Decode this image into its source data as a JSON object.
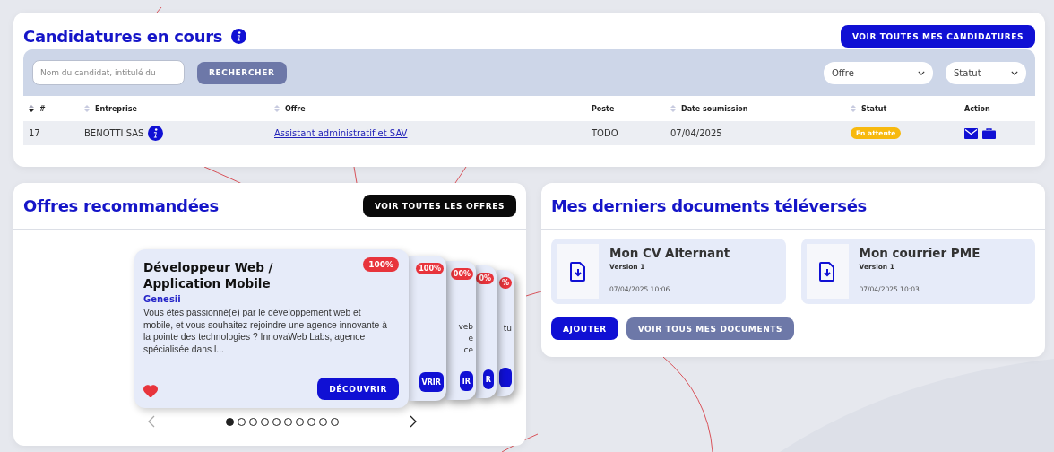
{
  "applications": {
    "title": "Candidatures en cours",
    "view_all": "VOIR TOUTES MES CANDIDATURES",
    "search": {
      "placeholder": "Nom du candidat, intitulé du",
      "button": "RECHERCHER"
    },
    "filters": [
      {
        "label": "Offre"
      },
      {
        "label": "Statut"
      }
    ],
    "columns": [
      {
        "label": "#",
        "sortable": true,
        "sorted": true
      },
      {
        "label": "Entreprise",
        "sortable": true,
        "sorted": false
      },
      {
        "label": "Offre",
        "sortable": true,
        "sorted": false
      },
      {
        "label": "Poste",
        "sortable": false,
        "sorted": false
      },
      {
        "label": "Date soumission",
        "sortable": true,
        "sorted": false
      },
      {
        "label": "Statut",
        "sortable": true,
        "sorted": false
      },
      {
        "label": "Action",
        "sortable": false,
        "sorted": false
      }
    ],
    "rows": [
      {
        "id": "17",
        "company": "BENOTTI SAS",
        "offer": "Assistant administratif et SAV",
        "position": "TODO",
        "date": "07/04/2025",
        "status": "En attente"
      }
    ]
  },
  "offers": {
    "title": "Offres recommandées",
    "view_all": "VOIR TOUTES LES OFFRES",
    "card": {
      "title": "Développeur Web / Application Mobile",
      "match": "100%",
      "company": "Genesii",
      "description": "Vous êtes passionné(e) par le développement web et mobile, et vous souhaitez rejoindre une agence innovante à la pointe des technologies ? InnovaWeb Labs, agence spécialisée dans l...",
      "favorite": true,
      "button": "DÉCOUVRIR"
    },
    "back_cards": [
      {
        "match": "100%",
        "button": "VRIR"
      },
      {
        "match": "00%",
        "fragments": [
          "veb",
          "e",
          "ce"
        ],
        "button": "IR"
      },
      {
        "match": "0%",
        "button": "R"
      },
      {
        "match": "%",
        "fragments": [
          "tu"
        ]
      }
    ],
    "carousel": {
      "prev_disabled": true,
      "dots": [
        {
          "selected": true
        },
        {
          "selected": false
        },
        {
          "selected": false
        },
        {
          "selected": false
        },
        {
          "selected": false
        },
        {
          "selected": false
        },
        {
          "selected": false
        },
        {
          "selected": false
        },
        {
          "selected": false
        },
        {
          "selected": false
        }
      ]
    }
  },
  "documents": {
    "title": "Mes derniers documents téléversés",
    "items": [
      {
        "name": "Mon CV Alternant",
        "version": "Version 1",
        "date": "07/04/2025 10:06"
      },
      {
        "name": "Mon courrier PME",
        "version": "Version 1",
        "date": "07/04/2025 10:03"
      }
    ],
    "add": "AJOUTER",
    "view_all": "VOIR TOUS MES DOCUMENTS"
  }
}
